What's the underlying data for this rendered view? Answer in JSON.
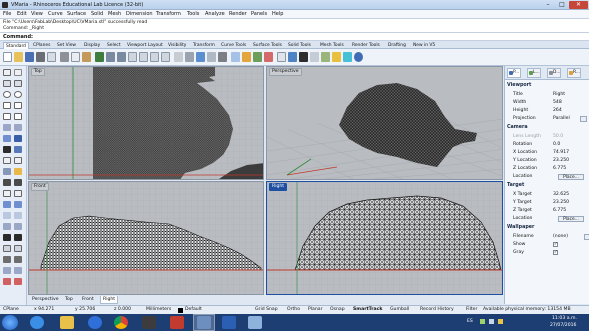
{
  "window": {
    "title": "VMaria - Rhinoceros Educational Lab Licence (32-bit)",
    "minimize": "–",
    "maximize": "□",
    "close": "✕"
  },
  "menu": [
    "File",
    "Edit",
    "View",
    "Curve",
    "Surface",
    "Solid",
    "Mesh",
    "Dimension",
    "Transform",
    "Tools",
    "Analyze",
    "Render",
    "Panels",
    "Help"
  ],
  "history": [
    "File \"C:\\Users\\FabLab\\Desktop\\UC\\VMaria.stl\" successfully read",
    "Command: _Right"
  ],
  "command_prompt": "Command:",
  "toolbar_tabs": [
    "Standard",
    "CPlanes",
    "Set View",
    "Display",
    "Select",
    "Viewport Layout",
    "Visibility",
    "Transform",
    "Curve Tools",
    "Surface Tools",
    "Solid Tools",
    "Mesh Tools",
    "Render Tools",
    "Drafting",
    "New in V5"
  ],
  "active_toolbar_tab": "Standard",
  "viewports": {
    "top": "Top",
    "perspective": "Perspective",
    "front": "Front",
    "right": "Right"
  },
  "viewport_tabs": [
    "Perspective",
    "Top",
    "Front",
    "Right"
  ],
  "active_viewport_tab": "Right",
  "panel": {
    "tab_labels": [
      "P...",
      "L...",
      "D...",
      "R..."
    ],
    "viewport_section": "Viewport",
    "viewport_rows": [
      {
        "label": "Title",
        "value": "Right"
      },
      {
        "label": "Width",
        "value": "548"
      },
      {
        "label": "Height",
        "value": "264"
      },
      {
        "label": "Projection",
        "value": "Parallel"
      }
    ],
    "camera_section": "Camera",
    "camera_rows": [
      {
        "label": "Lens Length",
        "value": "50.0"
      },
      {
        "label": "Rotation",
        "value": "0.0"
      },
      {
        "label": "X Location",
        "value": "74.917"
      },
      {
        "label": "Y Location",
        "value": "23.250"
      },
      {
        "label": "Z Location",
        "value": "6.775"
      }
    ],
    "camera_location_label": "Location",
    "place_label": "Place...",
    "target_section": "Target",
    "target_rows": [
      {
        "label": "X Target",
        "value": "32.625"
      },
      {
        "label": "Y Target",
        "value": "23.250"
      },
      {
        "label": "Z Target",
        "value": "6.775"
      }
    ],
    "target_location_label": "Location",
    "wallpaper_section": "Wallpaper",
    "wallpaper_rows": [
      {
        "label": "Filename",
        "value": "(none)"
      },
      {
        "label": "Show",
        "value": "✓"
      },
      {
        "label": "Gray",
        "value": "✓"
      }
    ]
  },
  "status": {
    "cplane": "CPlane",
    "x": "x 94.271",
    "y": "y 25.706",
    "z": "z 0.000",
    "units": "Millimeters",
    "layer": "Default",
    "toggles": [
      "Grid Snap",
      "Ortho",
      "Planar",
      "Osnap",
      "SmartTrack",
      "Gumball",
      "Record History",
      "Filter"
    ],
    "active_toggle": "SmartTrack",
    "memory": "Available physical memory: 13154 MB"
  },
  "taskbar": {
    "language": "ES",
    "time": "11:03 a.m.",
    "date": "27/07/2016"
  },
  "colors": {
    "titlebar": "#cfe0f4",
    "viewport_bg": "#b9bcc1",
    "active_viewport_label": "#1f4fa0",
    "x_axis": "#c0392b",
    "y_axis": "#2e8b3a",
    "taskbar": "#1d3e73"
  }
}
